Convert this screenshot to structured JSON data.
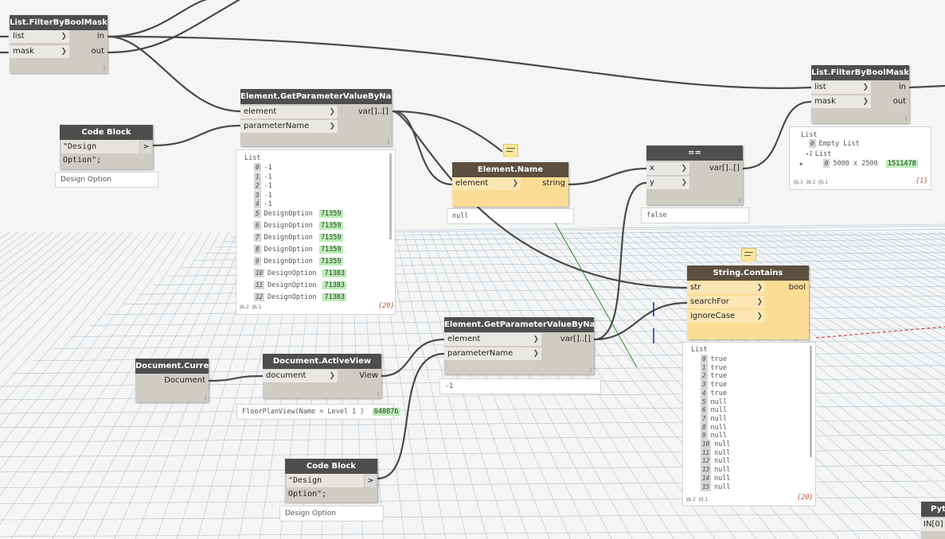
{
  "nodes": {
    "filter1": {
      "title": "List.FilterByBoolMask",
      "inputs": [
        "list",
        "mask"
      ],
      "outputs": [
        "in",
        "out"
      ]
    },
    "filter2": {
      "title": "List.FilterByBoolMask",
      "inputs": [
        "list",
        "mask"
      ],
      "outputs": [
        "in",
        "out"
      ]
    },
    "getparam1": {
      "title": "Element.GetParameterValueByName",
      "inputs": [
        "element",
        "parameterName"
      ],
      "outputs": [
        "var[]..[]"
      ]
    },
    "getparam2": {
      "title": "Element.GetParameterValueByName",
      "inputs": [
        "element",
        "parameterName"
      ],
      "outputs": [
        "var[]..[]"
      ]
    },
    "codeblock1": {
      "title": "Code Block",
      "code": "\"Design Option\";",
      "port": ">",
      "preview": "Design Option"
    },
    "codeblock2": {
      "title": "Code Block",
      "code": "\"Design Option\";",
      "port": ">",
      "preview": "Design Option"
    },
    "element_name": {
      "title": "Element.Name",
      "inputs": [
        "element"
      ],
      "outputs": [
        "string"
      ],
      "preview": "null"
    },
    "equals": {
      "title": "==",
      "inputs": [
        "x",
        "y"
      ],
      "outputs": [
        "var[]..[]"
      ],
      "preview": "false"
    },
    "string_contains": {
      "title": "String.Contains",
      "inputs": [
        "str",
        "searchFor",
        "ignoreCase"
      ],
      "outputs": [
        "bool"
      ]
    },
    "doc_current": {
      "title": "Document.Current",
      "outputs": [
        "Document"
      ]
    },
    "doc_activeview": {
      "title": "Document.ActiveView",
      "inputs": [
        "document"
      ],
      "outputs": [
        "View"
      ],
      "preview_text": "FloorPlanView(Name = Level 1 )",
      "preview_id": "640876"
    },
    "python": {
      "title": "Pyt",
      "port": "IN[0]"
    },
    "getparam2_preview": "-1"
  },
  "preview_getparam1": {
    "header": "List",
    "rows": [
      {
        "i": "0",
        "v": "-1",
        "id": ""
      },
      {
        "i": "1",
        "v": "-1",
        "id": ""
      },
      {
        "i": "2",
        "v": "-1",
        "id": ""
      },
      {
        "i": "3",
        "v": "-1",
        "id": ""
      },
      {
        "i": "4",
        "v": "-1",
        "id": ""
      },
      {
        "i": "5",
        "v": "DesignOption",
        "id": "71359"
      },
      {
        "i": "6",
        "v": "DesignOption",
        "id": "71359"
      },
      {
        "i": "7",
        "v": "DesignOption",
        "id": "71359"
      },
      {
        "i": "8",
        "v": "DesignOption",
        "id": "71359"
      },
      {
        "i": "9",
        "v": "DesignOption",
        "id": "71359"
      },
      {
        "i": "10",
        "v": "DesignOption",
        "id": "71383"
      },
      {
        "i": "11",
        "v": "DesignOption",
        "id": "71383"
      },
      {
        "i": "12",
        "v": "DesignOption",
        "id": "71383"
      }
    ],
    "levels": "@L2 @L1",
    "count": "{20}"
  },
  "preview_filter2": {
    "header": "List",
    "row0_idx": "0",
    "row0": "Empty List",
    "sub_idx": "1",
    "sub_header": "List",
    "row1_idx": "0",
    "row1": "5000 x 2500",
    "row1_id": "1511478",
    "levels": "@L3 @L2 @L1",
    "count": "{1}"
  },
  "preview_contains": {
    "header": "List",
    "rows": [
      {
        "i": "0",
        "v": "true"
      },
      {
        "i": "1",
        "v": "true"
      },
      {
        "i": "2",
        "v": "true"
      },
      {
        "i": "3",
        "v": "true"
      },
      {
        "i": "4",
        "v": "true"
      },
      {
        "i": "5",
        "v": "null"
      },
      {
        "i": "6",
        "v": "null"
      },
      {
        "i": "7",
        "v": "null"
      },
      {
        "i": "8",
        "v": "null"
      },
      {
        "i": "9",
        "v": "null"
      },
      {
        "i": "10",
        "v": "null"
      },
      {
        "i": "11",
        "v": "null"
      },
      {
        "i": "12",
        "v": "null"
      },
      {
        "i": "13",
        "v": "null"
      },
      {
        "i": "14",
        "v": "null"
      },
      {
        "i": "15",
        "v": "null"
      }
    ],
    "levels": "@L2 @L1",
    "count": "{20}"
  },
  "colors": {
    "wire": "#4a4a4a",
    "node_header": "#4e4e4e",
    "node_body": "#cfcbc5",
    "selected_body": "#fbdc95",
    "id_highlight": "#b9efb4",
    "grid": "#a9bfd0"
  }
}
